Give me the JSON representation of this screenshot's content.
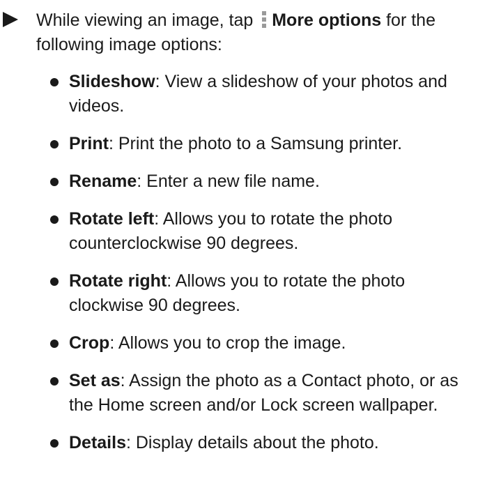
{
  "intro": {
    "before": "While viewing an image, tap ",
    "icon": "more-options-kebab-icon",
    "label": "More options",
    "after": " for the following image options:"
  },
  "options": [
    {
      "term": "Slideshow",
      "desc": ": View a slideshow of your photos and videos."
    },
    {
      "term": "Print",
      "desc": ": Print the photo to a Samsung printer."
    },
    {
      "term": "Rename",
      "desc": ": Enter a new file name."
    },
    {
      "term": "Rotate left",
      "desc": ": Allows you to rotate the photo counterclockwise 90 degrees."
    },
    {
      "term": "Rotate right",
      "desc": ": Allows you to rotate the photo clockwise 90 degrees."
    },
    {
      "term": "Crop",
      "desc": ": Allows you to crop the image."
    },
    {
      "term": "Set as",
      "desc": ": Assign the photo as a Contact photo, or as the Home screen and/or Lock screen wallpaper."
    },
    {
      "term": "Details",
      "desc": ": Display details about the photo."
    }
  ]
}
